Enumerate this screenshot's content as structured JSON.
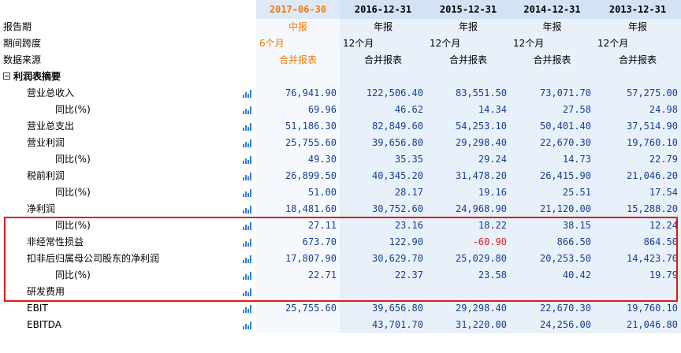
{
  "periods": [
    "2017-06-30",
    "2016-12-31",
    "2015-12-31",
    "2014-12-31",
    "2013-12-31"
  ],
  "meta": [
    {
      "label": "报告期",
      "values": [
        "中报",
        "年报",
        "年报",
        "年报",
        "年报"
      ]
    },
    {
      "label": "期间跨度",
      "values": [
        "6个月",
        "12个月",
        "12个月",
        "12个月",
        "12个月"
      ]
    },
    {
      "label": "数据来源",
      "values": [
        "合并报表",
        "合并报表",
        "合并报表",
        "合并报表",
        "合并报表"
      ]
    }
  ],
  "section": {
    "label": "利润表摘要"
  },
  "rows": [
    {
      "label": "营业总收入",
      "values": [
        "76,941.90",
        "122,506.40",
        "83,551.50",
        "73,071.70",
        "57,275.00"
      ]
    },
    {
      "label": "同比(%)",
      "values": [
        "69.96",
        "46.62",
        "14.34",
        "27.58",
        "24.98"
      ]
    },
    {
      "label": "营业总支出",
      "values": [
        "51,186.30",
        "82,849.60",
        "54,253.10",
        "50,401.40",
        "37,514.90"
      ]
    },
    {
      "label": "营业利润",
      "values": [
        "25,755.60",
        "39,656.80",
        "29,298.40",
        "22,670.30",
        "19,760.10"
      ]
    },
    {
      "label": "同比(%)",
      "values": [
        "49.30",
        "35.35",
        "29.24",
        "14.73",
        "22.79"
      ]
    },
    {
      "label": "税前利润",
      "values": [
        "26,899.50",
        "40,345.20",
        "31,478.20",
        "26,415.90",
        "21,046.20"
      ]
    },
    {
      "label": "同比(%)",
      "values": [
        "51.00",
        "28.17",
        "19.16",
        "25.51",
        "17.54"
      ]
    },
    {
      "label": "净利润",
      "values": [
        "18,481.60",
        "30,752.60",
        "24,968.90",
        "21,120.00",
        "15,288.20"
      ]
    },
    {
      "label": "同比(%)",
      "values": [
        "27.11",
        "23.16",
        "18.22",
        "38.15",
        "12.24"
      ]
    },
    {
      "label": "非经常性损益",
      "values": [
        "673.70",
        "122.90",
        "-60.90",
        "866.50",
        "864.50"
      ]
    },
    {
      "label": "扣非后归属母公司股东的净利润",
      "values": [
        "17,807.90",
        "30,629.70",
        "25,029.80",
        "20,253.50",
        "14,423.70"
      ]
    },
    {
      "label": "同比(%)",
      "values": [
        "22.71",
        "22.37",
        "23.58",
        "40.42",
        "19.79"
      ]
    },
    {
      "label": "研发费用",
      "values": [
        "",
        "",
        "",
        "",
        ""
      ]
    },
    {
      "label": "EBIT",
      "values": [
        "25,755.60",
        "39,656.80",
        "29,298.40",
        "22,670.30",
        "19,760.10"
      ]
    },
    {
      "label": "EBITDA",
      "values": [
        "",
        "43,701.70",
        "31,220.00",
        "24,256.00",
        "21,046.80"
      ]
    }
  ],
  "colors": {
    "header_bg": "#d3e3f5",
    "value_bg": "#e8f0fa",
    "current_period": "#f07a0a",
    "negative": "#e02020",
    "highlight_box": "#e01818"
  },
  "icons": {
    "row_chart": "bar-chart-icon",
    "collapse": "minus-box-icon"
  }
}
